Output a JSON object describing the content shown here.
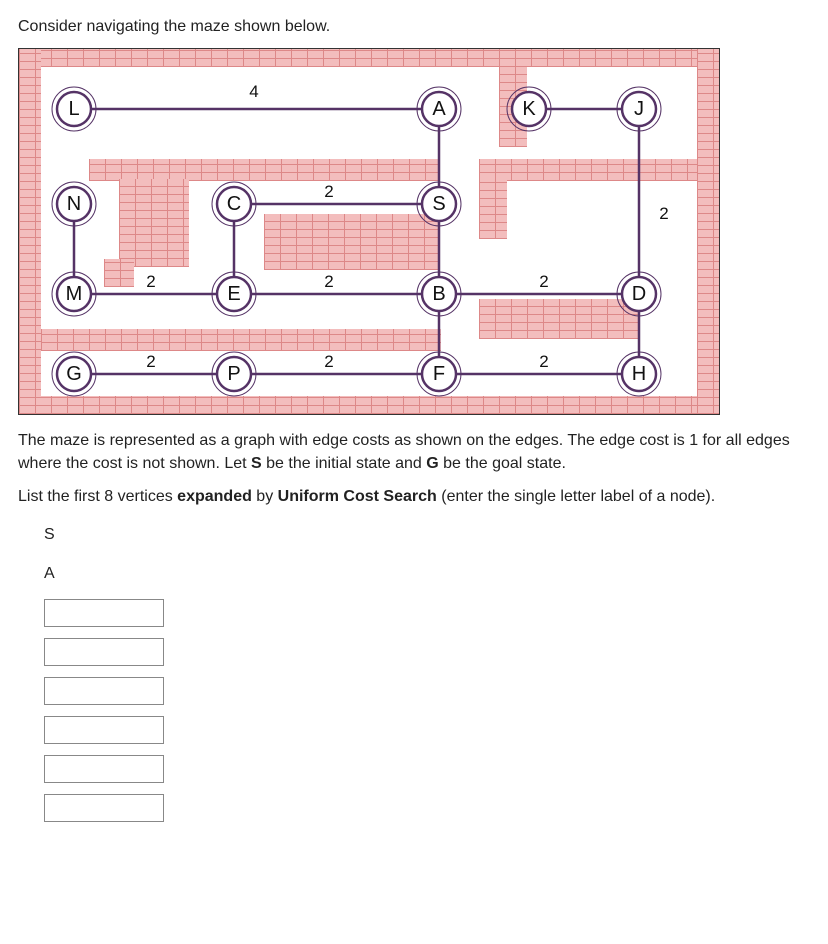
{
  "intro": "Consider navigating the maze shown below.",
  "explain1": "The maze is represented as a graph with edge costs as shown on the edges. The edge cost is 1 for all edges where the cost is not shown.  Let ",
  "explain1_b1": "S",
  "explain1_mid": " be the initial state and ",
  "explain1_b2": "G",
  "explain1_end": " be the goal state.",
  "explain2a": "List the first 8 vertices ",
  "explain2b": "expanded",
  "explain2c": " by ",
  "explain2d": "Uniform Cost Search",
  "explain2e": " (enter the single letter label of a node).",
  "answers_fixed": {
    "a1": "S",
    "a2": "A"
  },
  "nodes": {
    "L": "L",
    "A": "A",
    "K": "K",
    "J": "J",
    "N": "N",
    "C": "C",
    "S": "S",
    "M": "M",
    "E": "E",
    "B": "B",
    "D": "D",
    "G": "G",
    "P": "P",
    "F": "F",
    "H": "H"
  },
  "weights": {
    "LA": "4",
    "CS": "2",
    "JD": "2",
    "ME": "2",
    "EB": "2",
    "BD": "2",
    "GP": "2",
    "PF": "2",
    "FH": "2"
  }
}
